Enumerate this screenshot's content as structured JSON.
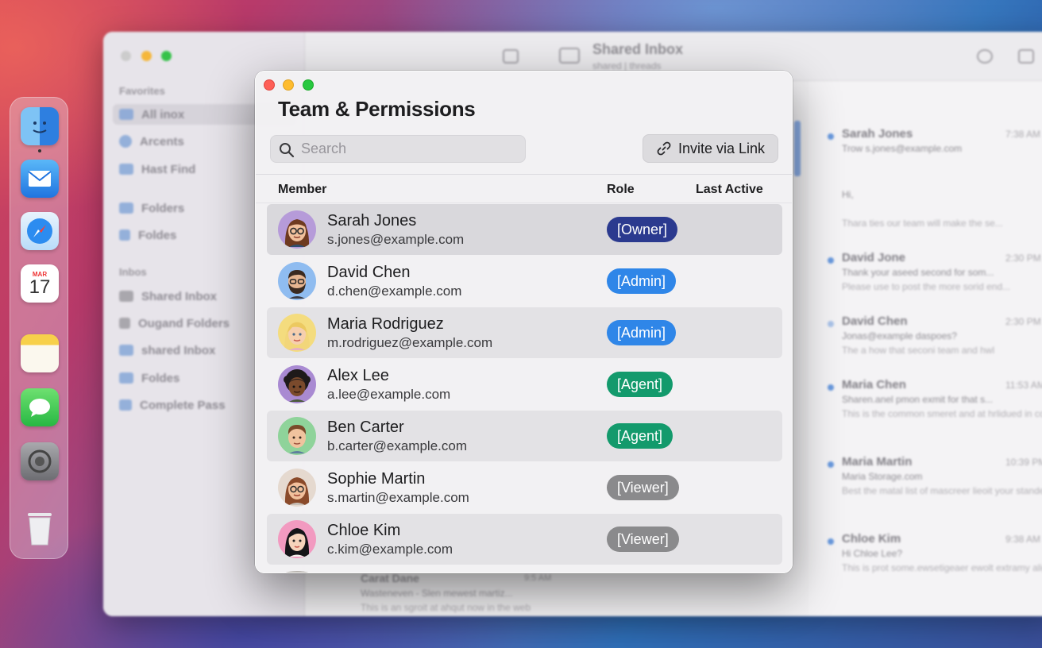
{
  "background_app": {
    "sidebar": {
      "favorites_title": "Favorites",
      "favorites": [
        "All inox",
        "Arcents",
        "Hast Find"
      ],
      "folders": [
        "Folders",
        "Foldes"
      ],
      "inbox_title": "Inbos",
      "inboxes": [
        "Shared Inbox",
        "Ougand Folders",
        "shared Inbox",
        "Foldes",
        "Complete Pass"
      ]
    },
    "toolbar": {
      "title": "Shared Inbox",
      "subtitle": "shared | threads"
    },
    "messages": [
      {
        "name": "Sarah Jones",
        "time": "7:38 AM",
        "subject": "Trow s.jones@example.com",
        "preview": "Hi,"
      },
      {
        "name": "",
        "time": "",
        "subject": "",
        "preview": "Thara ties our team will make the se..."
      },
      {
        "name": "David Jone",
        "time": "2:30 PM",
        "subject": "Thank your aseed second for som...",
        "preview": "Please use to post the more sorid end..."
      },
      {
        "name": "David Chen",
        "time": "2:30 PM",
        "subject": "Jonas@example daspoes?",
        "preview": "The a how that seconi team and hwl"
      },
      {
        "name": "Maria Chen",
        "time": "11:53 AM",
        "subject": "Sharen.anel pmon exmit for that s...",
        "preview": "This is the common smeret and at hrlidued in coll that are using oneme..."
      },
      {
        "name": "Maria Martin",
        "time": "10:39 PM",
        "subject": "Maria Storage.com",
        "preview": "Best the matal list of mascreer lieoit your standed anoke the same to the..."
      },
      {
        "name": "Chloe Kim",
        "time": "9:38 AM",
        "subject": "Hi Chloe Lee?",
        "preview": "This is prot some.ewsetigeaer ewolt extramy aligeot and Kim, are ald..."
      }
    ],
    "bottom_message": {
      "name": "Carat Dane",
      "time": "9:5 AM",
      "subject": "Wasteneven - Slen mewest martiz...",
      "preview": "This is an sgroit at ahqut now in the web"
    },
    "dock_calendar": {
      "month": "MAR",
      "day": "17"
    }
  },
  "dialog": {
    "title": "Team & Permissions",
    "search": {
      "placeholder": "Search",
      "value": ""
    },
    "invite_button": "Invite via Link",
    "columns": {
      "member": "Member",
      "role": "Role",
      "last_active": "Last Active"
    },
    "members": [
      {
        "name": "Sarah Jones",
        "email": "s.jones@example.com",
        "role": "[Owner]",
        "role_color": "#2b3a8f",
        "last_active": "",
        "avatar": "woman-glasses-brown-hair",
        "selected": true
      },
      {
        "name": "David Chen",
        "email": "d.chen@example.com",
        "role": "[Admin]",
        "role_color": "#2f86e8",
        "last_active": "",
        "avatar": "man-beard-glasses"
      },
      {
        "name": "Maria Rodriguez",
        "email": "m.rodriguez@example.com",
        "role": "[Admin]",
        "role_color": "#2f86e8",
        "last_active": "",
        "avatar": "woman-blonde"
      },
      {
        "name": "Alex Lee",
        "email": "a.lee@example.com",
        "role": "[Agent]",
        "role_color": "#139a6c",
        "last_active": "",
        "avatar": "person-curly-dark-hair"
      },
      {
        "name": "Ben Carter",
        "email": "b.carter@example.com",
        "role": "[Agent]",
        "role_color": "#139a6c",
        "last_active": "",
        "avatar": "man-short-hair"
      },
      {
        "name": "Sophie Martin",
        "email": "s.martin@example.com",
        "role": "[Viewer]",
        "role_color": "#8a8a8c",
        "last_active": "",
        "avatar": "woman-glasses-auburn-hair"
      },
      {
        "name": "Chloe Kim",
        "email": "c.kim@example.com",
        "role": "[Viewer]",
        "role_color": "#8a8a8c",
        "last_active": "",
        "avatar": "woman-black-hair"
      }
    ]
  }
}
